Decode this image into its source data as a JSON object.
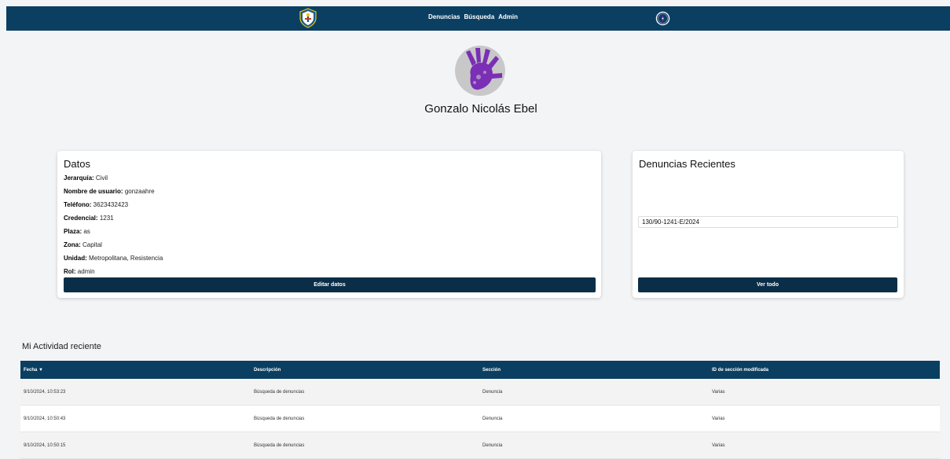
{
  "nav": {
    "links": [
      "Denuncias",
      "Búsqueda",
      "Admin"
    ]
  },
  "profile": {
    "name": "Gonzalo Nicolás Ebel"
  },
  "datos": {
    "title": "Datos",
    "fields": [
      {
        "label": "Jerarquía:",
        "value": "Civil"
      },
      {
        "label": "Nombre de usuario:",
        "value": "gonzaahre"
      },
      {
        "label": "Teléfono:",
        "value": "3623432423"
      },
      {
        "label": "Credencial:",
        "value": "1231"
      },
      {
        "label": "Plaza:",
        "value": "as"
      },
      {
        "label": "Zona:",
        "value": "Capital"
      },
      {
        "label": "Unidad:",
        "value": "Metropolitana, Resistencia"
      },
      {
        "label": "Rol:",
        "value": "admin"
      }
    ],
    "edit_button": "Editar datos"
  },
  "recientes": {
    "title": "Denuncias Recientes",
    "items": [
      "130/90-1241-E/2024"
    ],
    "view_all_button": "Ver todo"
  },
  "activity": {
    "title": "Mi Actividad reciente",
    "columns": [
      "Fecha ▼",
      "Descripción",
      "Sección",
      "ID de sección modificada"
    ],
    "rows": [
      [
        "9/10/2024, 10:53:23",
        "Búsqueda de denuncias",
        "Denuncia",
        "Varias"
      ],
      [
        "9/10/2024, 10:50:43",
        "Búsqueda de denuncias",
        "Denuncia",
        "Varias"
      ],
      [
        "9/10/2024, 10:50:15",
        "Búsqueda de denuncias",
        "Denuncia",
        "Varias"
      ]
    ]
  },
  "colors": {
    "navbar": "#0b3f62",
    "button": "#0b2e48",
    "accent_purple": "#7a2fb5"
  },
  "icons": {
    "logo": "police-shield-icon",
    "compass": "compass-icon",
    "avatar": "hand-print-icon"
  }
}
